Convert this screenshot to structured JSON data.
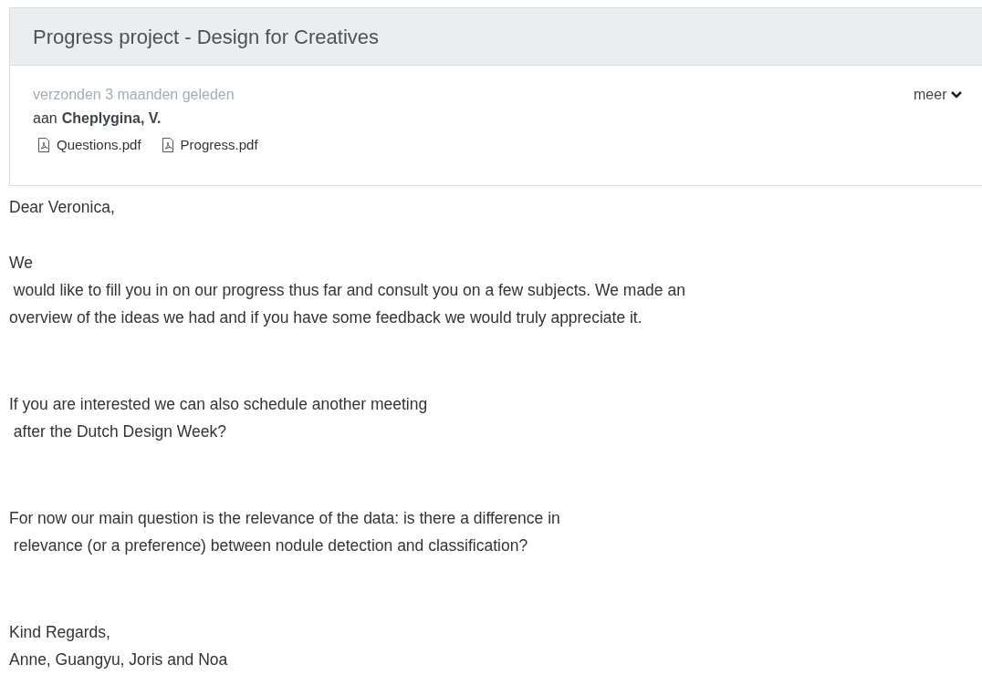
{
  "subject": "Progress project - Design for Creatives",
  "meta": {
    "sent": "verzonden 3 maanden geleden",
    "to_prefix": "aan",
    "recipient": "Cheplygina, V.",
    "more": "meer"
  },
  "attachments": [
    "Questions.pdf",
    "Progress.pdf"
  ],
  "body": [
    {
      "lines": [
        "Dear Veronica,"
      ]
    },
    {
      "lines": [
        "We",
        " would like to fill you in on our progress thus far and consult you on a few subjects. We made an",
        "overview of the ideas we had and if you have some feedback we would truly appreciate it."
      ]
    },
    {
      "lines": [
        "If you are interested we can also schedule another meeting",
        " after the Dutch Design Week?"
      ]
    },
    {
      "lines": [
        "For now our main question is the relevance of the data: is there a difference in",
        " relevance (or a preference) between nodule detection and classification?"
      ]
    },
    {
      "lines": [
        "Kind Regards,",
        "Anne, Guangyu, Joris and Noa"
      ]
    }
  ]
}
